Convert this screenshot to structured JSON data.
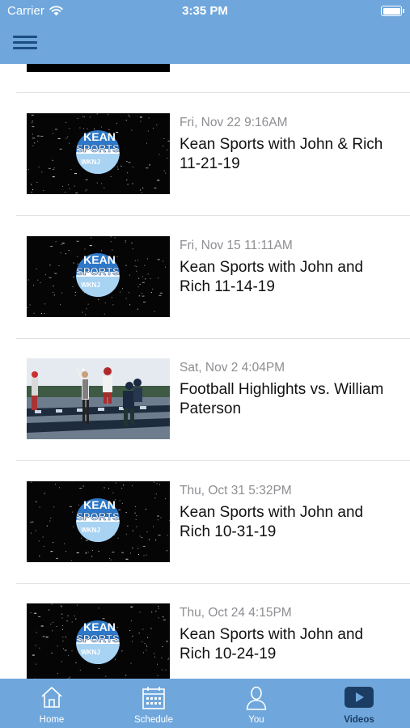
{
  "status_bar": {
    "carrier": "Carrier",
    "time": "3:35 PM"
  },
  "header": {
    "menu_icon": "hamburger-menu-icon"
  },
  "videos": [
    {
      "date": "Fri, Nov 22 9:16AM",
      "title": "Kean Sports with John & Rich 11-21-19",
      "thumbnail": "kean-sports-logo"
    },
    {
      "date": "Fri, Nov 15 11:11AM",
      "title": "Kean Sports with John and Rich 11-14-19",
      "thumbnail": "kean-sports-logo"
    },
    {
      "date": "Sat, Nov 2 4:04PM",
      "title": "Football Highlights vs. William Paterson",
      "thumbnail": "football-field"
    },
    {
      "date": "Thu, Oct 31 5:32PM",
      "title": "Kean Sports with John and Rich 10-31-19",
      "thumbnail": "kean-sports-logo"
    },
    {
      "date": "Thu, Oct 24 4:15PM",
      "title": "Kean Sports with John and Rich 10-24-19",
      "thumbnail": "kean-sports-logo"
    }
  ],
  "thumbnail_text": {
    "logo_line1": "KEAN",
    "logo_line2": "SPORTS",
    "logo_line3": "WKNJ"
  },
  "tabs": [
    {
      "label": "Home",
      "icon": "home-icon"
    },
    {
      "label": "Schedule",
      "icon": "calendar-icon"
    },
    {
      "label": "You",
      "icon": "person-icon"
    },
    {
      "label": "Videos",
      "icon": "play-icon",
      "active": true
    }
  ],
  "colors": {
    "bar": "#6fa7dc",
    "menu_icon": "#1c4d80",
    "active_tab": "#1c3d63",
    "date_text": "#8e8e93"
  }
}
